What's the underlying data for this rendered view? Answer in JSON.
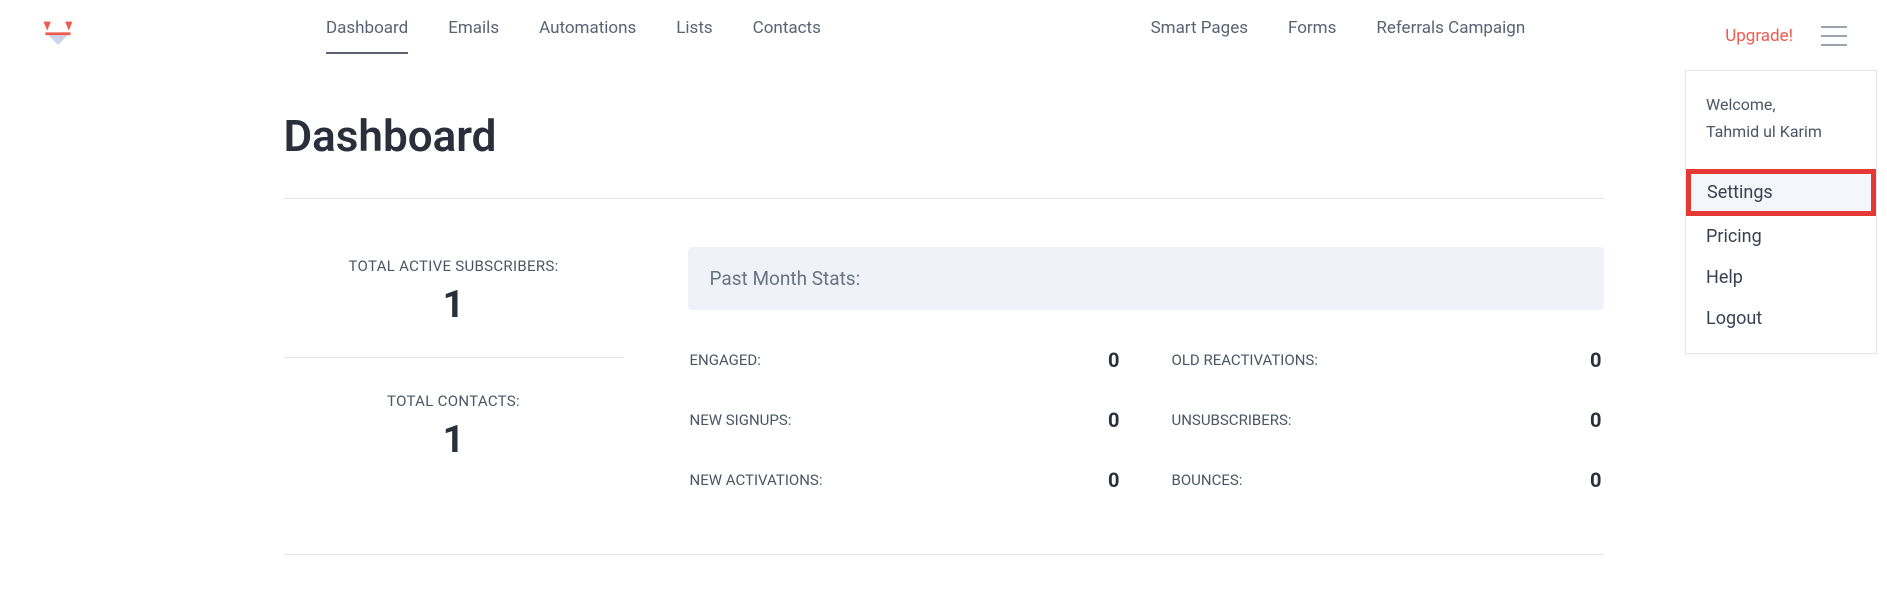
{
  "nav": {
    "left": [
      "Dashboard",
      "Emails",
      "Automations",
      "Lists",
      "Contacts"
    ],
    "right": [
      "Smart Pages",
      "Forms",
      "Referrals Campaign"
    ],
    "active_index": 0,
    "upgrade": "Upgrade!"
  },
  "dropdown": {
    "welcome_label": "Welcome,",
    "user_name": "Tahmid ul Karim",
    "items": [
      "Settings",
      "Pricing",
      "Help",
      "Logout"
    ],
    "highlight_index": 0
  },
  "page": {
    "title": "Dashboard"
  },
  "summary": {
    "active_subscribers_label": "TOTAL ACTIVE SUBSCRIBERS:",
    "active_subscribers_value": "1",
    "total_contacts_label": "TOTAL CONTACTS:",
    "total_contacts_value": "1"
  },
  "panel": {
    "header": "Past Month Stats:",
    "col1": [
      {
        "label": "ENGAGED:",
        "value": "0"
      },
      {
        "label": "NEW SIGNUPS:",
        "value": "0"
      },
      {
        "label": "NEW ACTIVATIONS:",
        "value": "0"
      }
    ],
    "col2": [
      {
        "label": "OLD REACTIVATIONS:",
        "value": "0"
      },
      {
        "label": "UNSUBSCRIBERS:",
        "value": "0"
      },
      {
        "label": "BOUNCES:",
        "value": "0"
      }
    ]
  }
}
